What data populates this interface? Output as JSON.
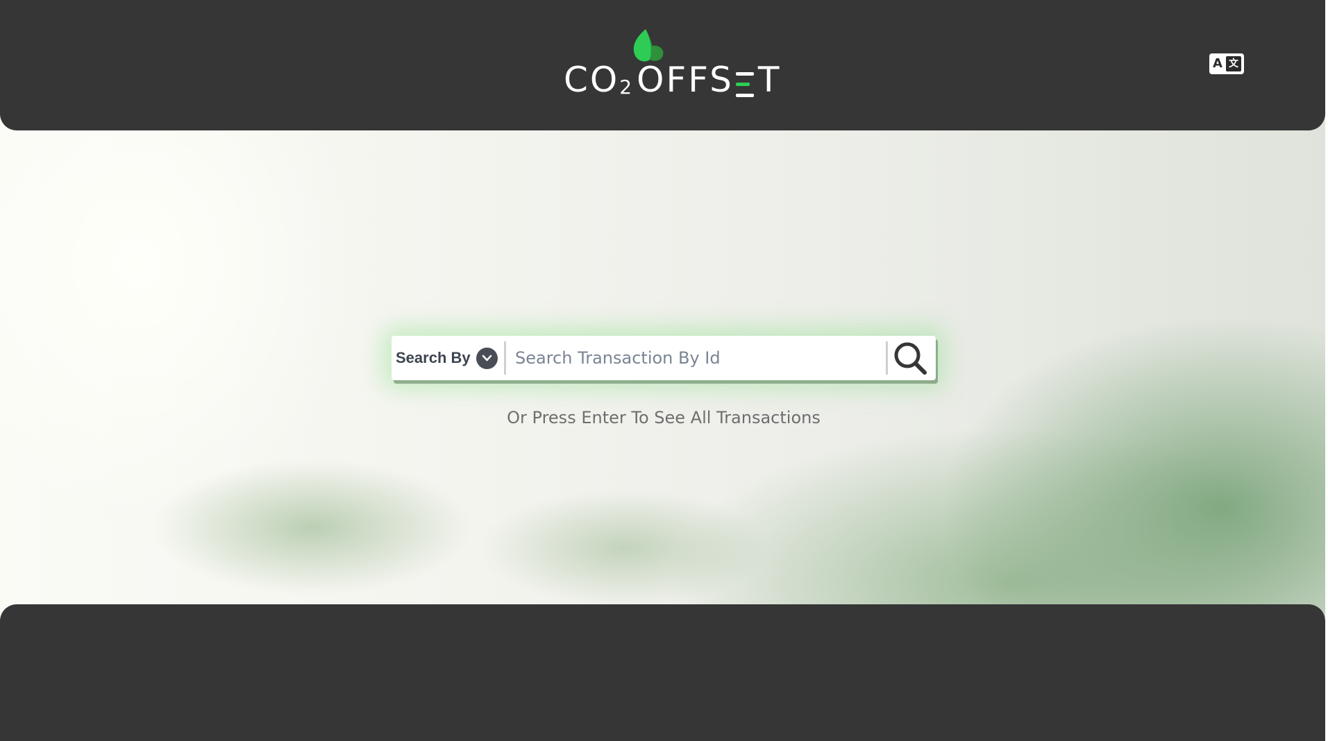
{
  "header": {
    "logo": {
      "brand": "CO2OFFSET",
      "part_co": "CO",
      "part_sub": "2",
      "part_offs": "OFFS",
      "part_t": "T",
      "leaf_colors": [
        "#34d058",
        "#1aa83a",
        "#2f8f3b"
      ],
      "e_colors": [
        "#ffffff",
        "#2ecc55",
        "#ffffff"
      ]
    },
    "language_button": {
      "icon": "translate-icon",
      "glyph_a": "A",
      "glyph_b": "文"
    }
  },
  "search": {
    "search_by_label": "Search By",
    "search_by_icon": "chevron-down-icon",
    "input_placeholder": "Search Transaction By Id",
    "input_value": "",
    "submit_icon": "search-icon",
    "hint": "Or Press Enter To See All Transactions"
  },
  "colors": {
    "header_bg": "#363636",
    "footer_bg": "#363636",
    "accent_green": "#2ecc55",
    "hint_text": "#6e6e6e"
  }
}
